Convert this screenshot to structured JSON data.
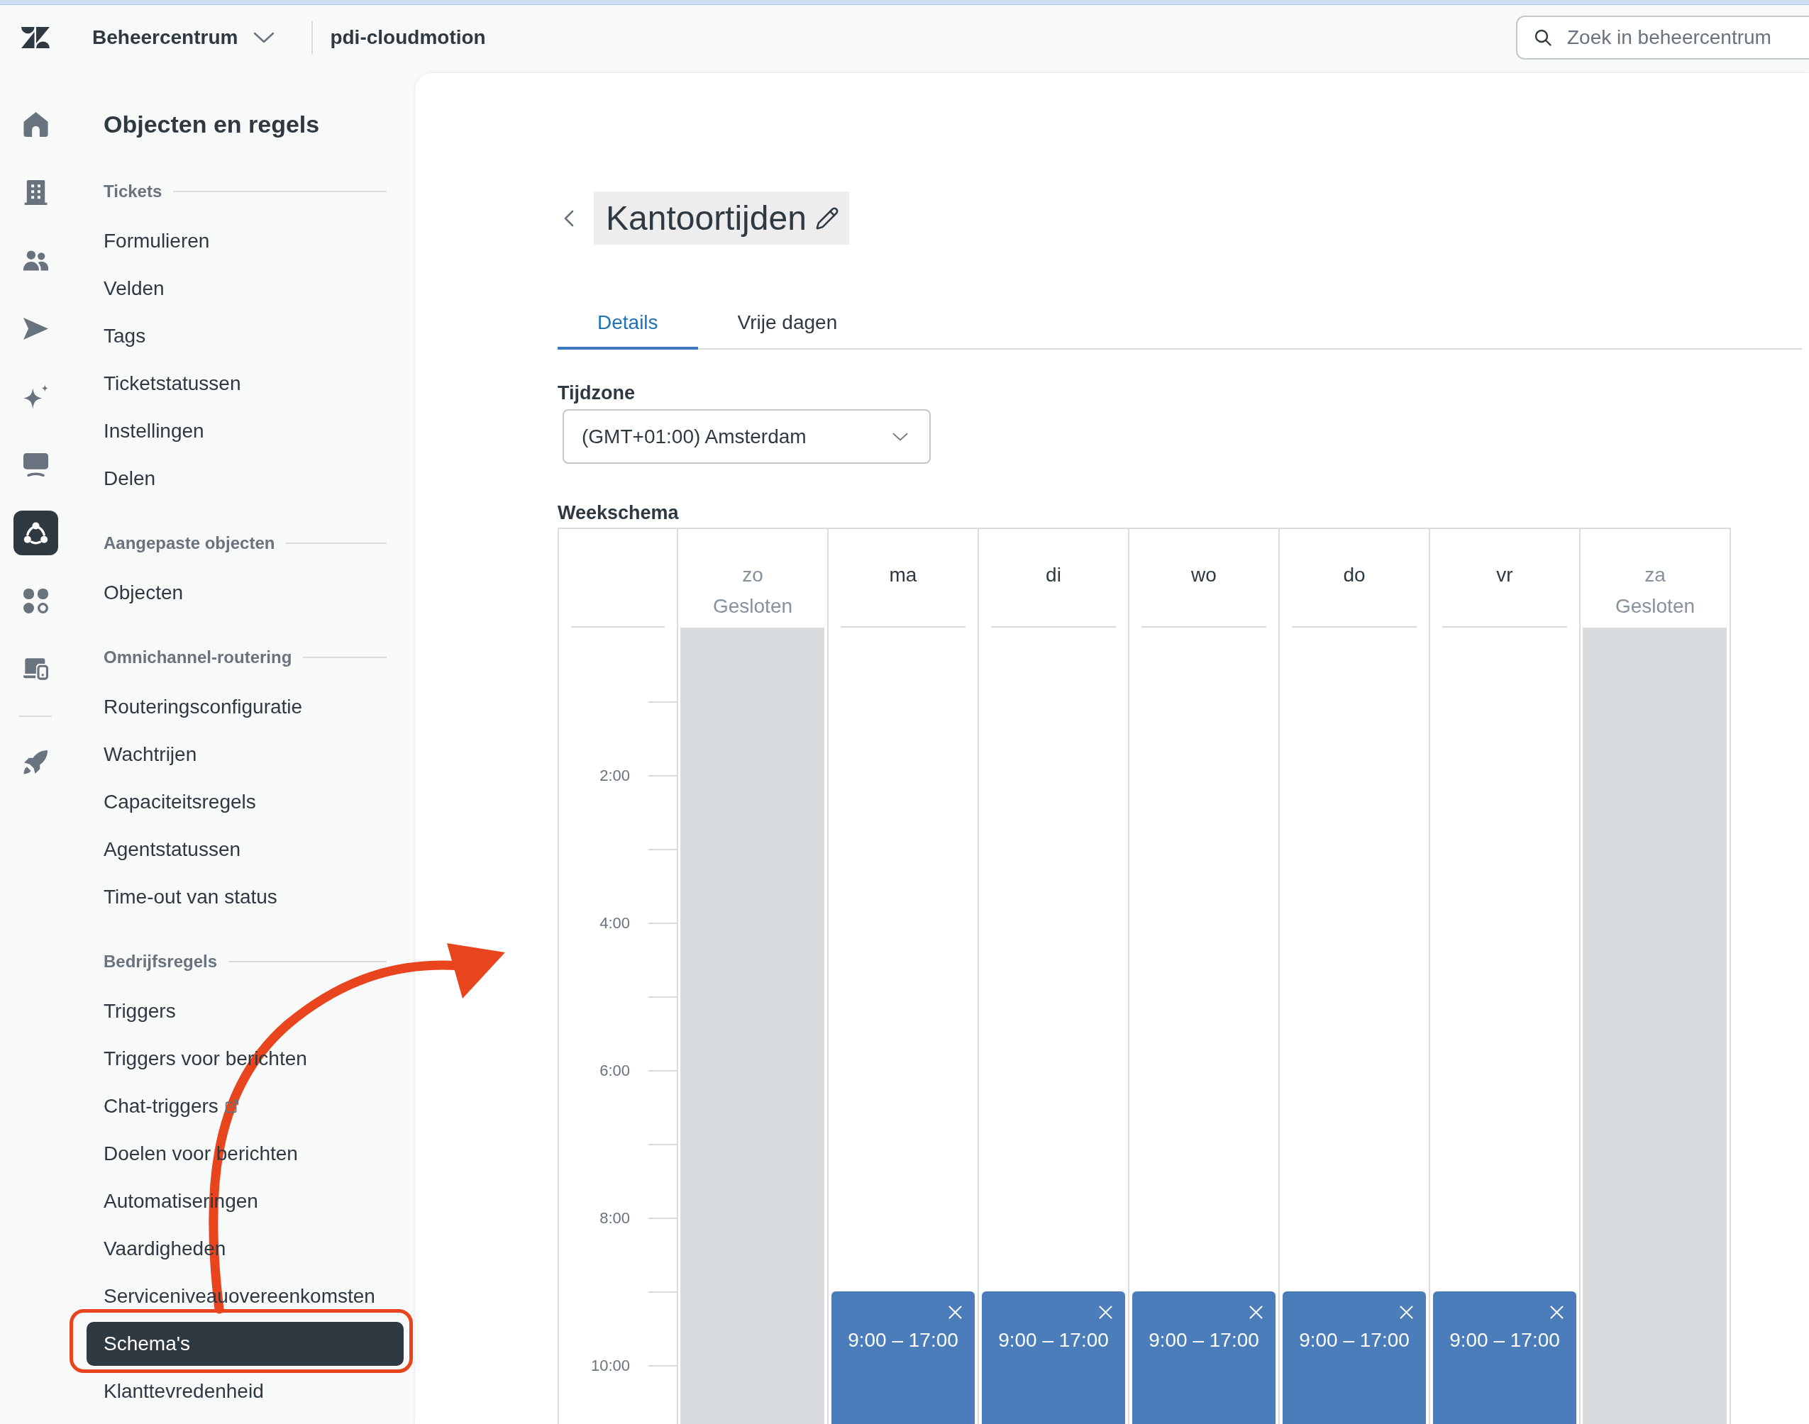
{
  "top_bar": {
    "product": "Beheercentrum",
    "account": "pdi-cloudmotion",
    "search": {
      "placeholder": "Zoek in beheercentrum"
    }
  },
  "rail": {
    "groups": [
      [
        {
          "kind": "home",
          "selected": false
        },
        {
          "kind": "building",
          "selected": false
        },
        {
          "kind": "users",
          "selected": false
        },
        {
          "kind": "send",
          "selected": false
        },
        {
          "kind": "sparkle",
          "selected": false
        },
        {
          "kind": "monitor",
          "selected": false
        },
        {
          "kind": "objects",
          "selected": true
        },
        {
          "kind": "apps",
          "selected": false
        },
        {
          "kind": "devices",
          "selected": false
        }
      ],
      [
        {
          "kind": "rocket",
          "selected": false
        }
      ]
    ]
  },
  "nav": {
    "title": "Objecten en regels",
    "sections": [
      {
        "heading": "Tickets",
        "items": [
          {
            "label": "Formulieren",
            "selected": false,
            "external": false
          },
          {
            "label": "Velden",
            "selected": false,
            "external": false
          },
          {
            "label": "Tags",
            "selected": false,
            "external": false
          },
          {
            "label": "Ticketstatussen",
            "selected": false,
            "external": false
          },
          {
            "label": "Instellingen",
            "selected": false,
            "external": false
          },
          {
            "label": "Delen",
            "selected": false,
            "external": false
          }
        ]
      },
      {
        "heading": "Aangepaste objecten",
        "items": [
          {
            "label": "Objecten",
            "selected": false,
            "external": false
          }
        ]
      },
      {
        "heading": "Omnichannel-routering",
        "items": [
          {
            "label": "Routeringsconfiguratie",
            "selected": false,
            "external": false
          },
          {
            "label": "Wachtrijen",
            "selected": false,
            "external": false
          },
          {
            "label": "Capaciteitsregels",
            "selected": false,
            "external": false
          },
          {
            "label": "Agentstatussen",
            "selected": false,
            "external": false
          },
          {
            "label": "Time-out van status",
            "selected": false,
            "external": false
          }
        ]
      },
      {
        "heading": "Bedrijfsregels",
        "items": [
          {
            "label": "Triggers",
            "selected": false,
            "external": false
          },
          {
            "label": "Triggers voor berichten",
            "selected": false,
            "external": false
          },
          {
            "label": "Chat-triggers",
            "selected": false,
            "external": true
          },
          {
            "label": "Doelen voor berichten",
            "selected": false,
            "external": false
          },
          {
            "label": "Automatiseringen",
            "selected": false,
            "external": false
          },
          {
            "label": "Vaardigheden",
            "selected": false,
            "external": false
          },
          {
            "label": "Serviceniveauovereenkomsten",
            "selected": false,
            "external": false
          },
          {
            "label": "Schema's",
            "selected": true,
            "external": false
          },
          {
            "label": "Klanttevredenheid",
            "selected": false,
            "external": false
          }
        ]
      }
    ]
  },
  "page": {
    "title": "Kantoortijden",
    "tabs": [
      {
        "label": "Details",
        "selected": true
      },
      {
        "label": "Vrije dagen",
        "selected": false
      }
    ],
    "timezone": {
      "label": "Tijdzone",
      "value": "(GMT+01:00) Amsterdam"
    },
    "schedule": {
      "title": "Weekschema",
      "hour_labels": [
        "2:00",
        "4:00",
        "6:00",
        "8:00",
        "10:00"
      ],
      "days": [
        {
          "name": "zo",
          "closed": true,
          "note": "Gesloten"
        },
        {
          "name": "ma",
          "closed": false,
          "blocks": [
            {
              "time": "9:00 – 17:00"
            }
          ]
        },
        {
          "name": "di",
          "closed": false,
          "blocks": [
            {
              "time": "9:00 – 17:00"
            }
          ]
        },
        {
          "name": "wo",
          "closed": false,
          "blocks": [
            {
              "time": "9:00 – 17:00"
            }
          ]
        },
        {
          "name": "do",
          "closed": false,
          "blocks": [
            {
              "time": "9:00 – 17:00"
            }
          ]
        },
        {
          "name": "vr",
          "closed": false,
          "blocks": [
            {
              "time": "9:00 – 17:00"
            }
          ]
        },
        {
          "name": "za",
          "closed": true,
          "note": "Gesloten"
        }
      ]
    }
  }
}
